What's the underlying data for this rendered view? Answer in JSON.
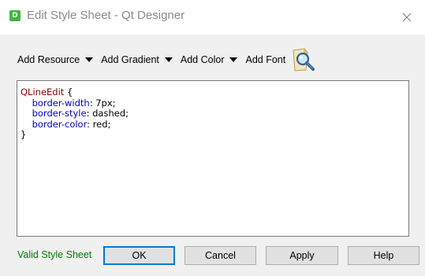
{
  "window": {
    "title": "Edit Style Sheet - Qt Designer",
    "app_icon_letter": "D",
    "close_glyph": "close-icon"
  },
  "toolbar": {
    "add_resource": "Add Resource",
    "add_gradient": "Add Gradient",
    "add_color": "Add Color",
    "add_font": "Add Font",
    "magnifier_icon": "magnifier-icon"
  },
  "editor": {
    "lines": [
      {
        "selector": "QLineEdit",
        "rest": " {"
      },
      {
        "prop": "border-width",
        "value": ": 7px;"
      },
      {
        "prop": "border-style",
        "value": ": dashed;"
      },
      {
        "prop": "border-color",
        "value": ": red;"
      },
      {
        "close": "}"
      }
    ]
  },
  "footer": {
    "status": "Valid Style Sheet",
    "ok": "OK",
    "cancel": "Cancel",
    "apply": "Apply",
    "help": "Help"
  },
  "colors": {
    "status_green": "#067c06",
    "selector": "#8b0000",
    "property": "#0000c8",
    "focus_border": "#0078d7"
  }
}
